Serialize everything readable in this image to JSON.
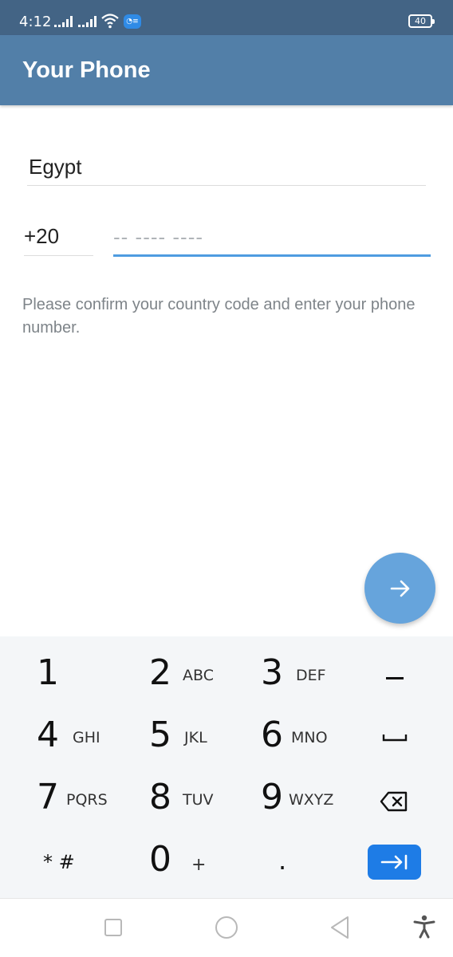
{
  "status_bar": {
    "time": "4:12",
    "battery": "40",
    "icons": [
      "signal-icon",
      "signal-icon",
      "wifi-icon",
      "message-notification-icon",
      "battery-icon"
    ]
  },
  "app_bar": {
    "title": "Your Phone"
  },
  "form": {
    "country": "Egypt",
    "country_code": "+20",
    "phone_value": "",
    "phone_placeholder": "-- ---- ----",
    "hint": "Please confirm your country code and enter your phone number."
  },
  "fab": {
    "icon": "arrow-right-icon"
  },
  "keyboard": {
    "rows": [
      [
        {
          "digit": "1",
          "letters": ""
        },
        {
          "digit": "2",
          "letters": "ABC"
        },
        {
          "digit": "3",
          "letters": "DEF"
        },
        {
          "digit": "–",
          "letters": ""
        }
      ],
      [
        {
          "digit": "4",
          "letters": "GHI"
        },
        {
          "digit": "5",
          "letters": "JKL"
        },
        {
          "digit": "6",
          "letters": "MNO"
        },
        {
          "digit": "space",
          "letters": ""
        }
      ],
      [
        {
          "digit": "7",
          "letters": "PQRS"
        },
        {
          "digit": "8",
          "letters": "TUV"
        },
        {
          "digit": "9",
          "letters": "WXYZ"
        },
        {
          "digit": "backspace",
          "letters": ""
        }
      ],
      [
        {
          "digit": "* #",
          "letters": ""
        },
        {
          "digit": "0",
          "letters": "+"
        },
        {
          "digit": ".",
          "letters": ""
        },
        {
          "digit": "go",
          "letters": ""
        }
      ]
    ]
  },
  "nav_bar": {
    "icons": [
      "recent-apps-icon",
      "home-icon",
      "back-icon",
      "accessibility-icon"
    ]
  },
  "colors": {
    "status_bar": "#436485",
    "app_bar": "#527fa8",
    "accent": "#4f9ce0",
    "fab": "#66a4dc",
    "go_key": "#1e7ce6"
  }
}
